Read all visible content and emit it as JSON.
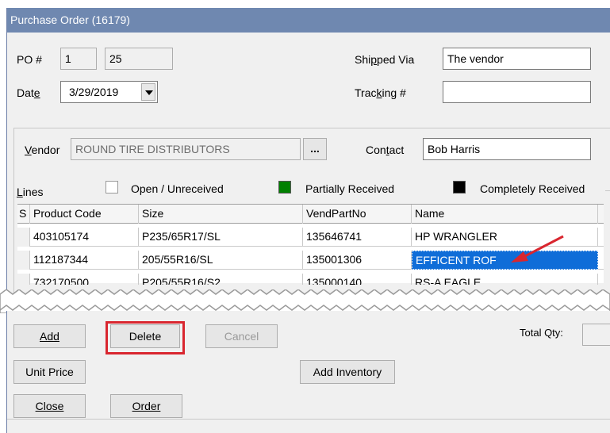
{
  "window": {
    "title": "Purchase Order (16179)"
  },
  "header": {
    "po_label": "PO #",
    "po_number_1": "1",
    "po_number_2": "25",
    "shipped_via_label": "Shipped Via",
    "shipped_via_value": "The vendor",
    "date_label": "Date",
    "date_value": "3/29/2019",
    "tracking_label": "Tracking #",
    "tracking_value": ""
  },
  "vendor": {
    "label": "Vendor",
    "value": "ROUND TIRE DISTRIBUTORS",
    "browse_label": "...",
    "contact_label": "Contact",
    "contact_value": "Bob Harris"
  },
  "legend": {
    "lines_label": "Lines",
    "open": {
      "label": "Open / Unreceived",
      "color": "#ffffff"
    },
    "partial": {
      "label": "Partially Received",
      "color": "#008000"
    },
    "complete": {
      "label": "Completely Received",
      "color": "#000000"
    }
  },
  "grid": {
    "columns": [
      "S",
      "Product Code",
      "Size",
      "VendPartNo",
      "Name"
    ],
    "rows": [
      {
        "status": "",
        "product_code": "403105174",
        "size": "P235/65R17/SL",
        "vend_part_no": "135646741",
        "name": "HP WRANGLER"
      },
      {
        "status": "",
        "product_code": "112187344",
        "size": "205/55R16/SL",
        "vend_part_no": "135001306",
        "name": "EFFICENT ROF"
      },
      {
        "status": "",
        "product_code": "732170500",
        "size": "P205/55R16/S2",
        "vend_part_no": "135000140",
        "name": "RS-A EAGLE"
      }
    ],
    "selected_color": "#0f6dd8"
  },
  "buttons": {
    "add": "Add",
    "delete": "Delete",
    "cancel": "Cancel",
    "unit_price": "Unit Price",
    "add_inventory": "Add Inventory",
    "close": "Close",
    "order": "Order"
  },
  "totals": {
    "total_qty_label": "Total Qty:",
    "total_qty_value": ""
  },
  "annotation_color": "#d9262f"
}
